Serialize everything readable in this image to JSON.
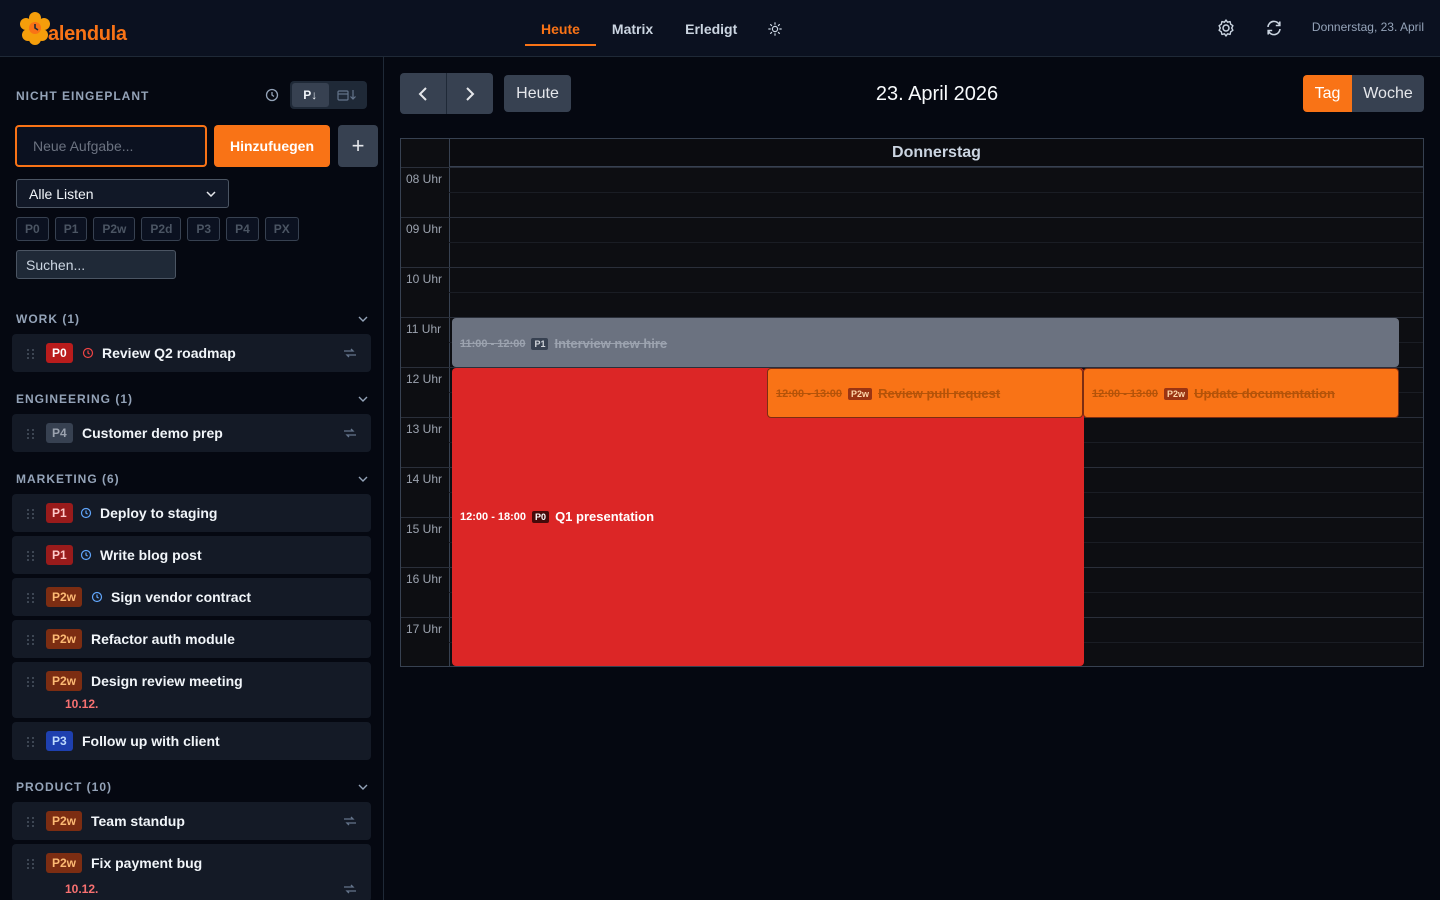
{
  "app": {
    "name": "alendula"
  },
  "header": {
    "tabs": [
      {
        "label": "Heute",
        "active": true
      },
      {
        "label": "Matrix",
        "active": false
      },
      {
        "label": "Erledigt",
        "active": false
      }
    ],
    "date": "Donnerstag, 23. April"
  },
  "sidebar": {
    "title": "NICHT EINGEPLANT",
    "sort_priority_label": "P↓",
    "new_task_placeholder": "Neue Aufgabe...",
    "add_label": "Hinzufuegen",
    "list_filter": "Alle Listen",
    "priority_filters": [
      "P0",
      "P1",
      "P2w",
      "P2d",
      "P3",
      "P4",
      "PX"
    ],
    "search_placeholder": "Suchen...",
    "groups": [
      {
        "name": "WORK (1)",
        "tasks": [
          {
            "priority": "P0",
            "title": "Review Q2 roadmap",
            "icon": "overdue-clock-icon",
            "pinned": true
          }
        ]
      },
      {
        "name": "ENGINEERING (1)",
        "tasks": [
          {
            "priority": "P4",
            "title": "Customer demo prep",
            "pinned": true
          }
        ]
      },
      {
        "name": "MARKETING (6)",
        "tasks": [
          {
            "priority": "P1",
            "title": "Deploy to staging",
            "icon": "clock-icon"
          },
          {
            "priority": "P1",
            "title": "Write blog post",
            "icon": "clock-icon"
          },
          {
            "priority": "P2w",
            "title": "Sign vendor contract",
            "icon": "clock-icon"
          },
          {
            "priority": "P2w",
            "title": "Refactor auth module"
          },
          {
            "priority": "P2w",
            "title": "Design review meeting",
            "due": "10.12."
          },
          {
            "priority": "P3",
            "title": "Follow up with client"
          }
        ]
      },
      {
        "name": "PRODUCT (10)",
        "tasks": [
          {
            "priority": "P2w",
            "title": "Team standup",
            "pinned": true
          },
          {
            "priority": "P2w",
            "title": "Fix payment bug",
            "due": "10.12.",
            "pinned": true
          }
        ]
      }
    ]
  },
  "calendar": {
    "today_label": "Heute",
    "title": "23. April 2026",
    "views": {
      "day": "Tag",
      "week": "Woche",
      "active": "day"
    },
    "day_header": "Donnerstag",
    "hours": [
      "08 Uhr",
      "09 Uhr",
      "10 Uhr",
      "11 Uhr",
      "12 Uhr",
      "13 Uhr",
      "14 Uhr",
      "15 Uhr",
      "16 Uhr",
      "17 Uhr"
    ],
    "events": [
      {
        "time": "11:00 - 12:00",
        "priority": "P1",
        "title": "Interview new hire",
        "done": true,
        "color": "#6b7280"
      },
      {
        "time": "12:00 - 18:00",
        "priority": "P0",
        "title": "Q1 presentation",
        "done": false,
        "color": "#dc2626"
      },
      {
        "time": "12:00 - 13:00",
        "priority": "P2w",
        "title": "Review pull request",
        "done": true,
        "color": "#f97316"
      },
      {
        "time": "12:00 - 13:00",
        "priority": "P2w",
        "title": "Update documentation",
        "done": true,
        "color": "#f97316"
      }
    ]
  },
  "colors": {
    "accent": "#f97316",
    "p0": "#dc2626",
    "done_gray": "#6b7280"
  }
}
